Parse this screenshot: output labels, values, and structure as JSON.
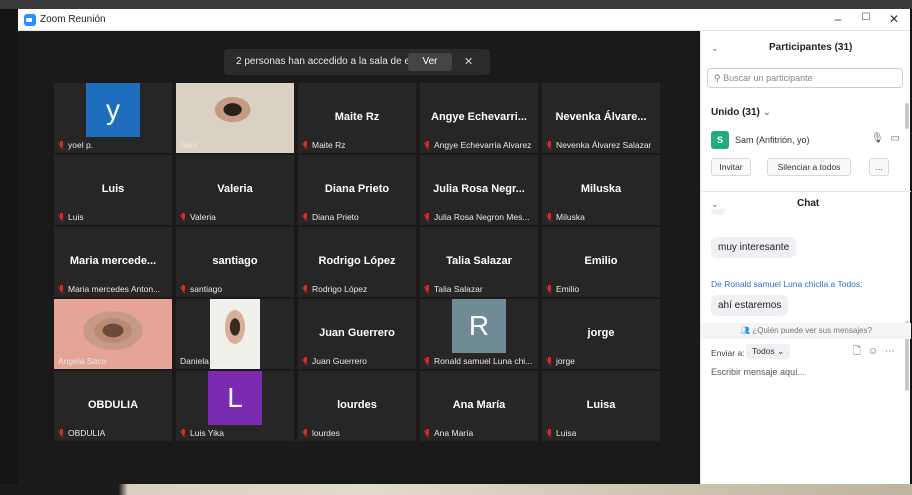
{
  "window": {
    "title": "Zoom Reunión",
    "minimize": "–",
    "maximize": "☐",
    "close": "✕"
  },
  "banner": {
    "text": "2 personas han accedido a la sala de espera",
    "button": "Ver",
    "close": "✕"
  },
  "tiles": [
    {
      "name": "",
      "label": "yoel p.",
      "letter": "y",
      "letter_color": "#1f6dbd"
    },
    {
      "name": "",
      "label": "Sam",
      "photo": true
    },
    {
      "name": "Maite Rz",
      "label": "Maite Rz"
    },
    {
      "name": "Angye Echevarri...",
      "label": "Angye Echevarria Alvarez"
    },
    {
      "name": "Nevenka Álvare...",
      "label": "Nevenka Álvarez Salazar"
    },
    {
      "name": "Luis",
      "label": "Luis"
    },
    {
      "name": "Valeria",
      "label": "Valeria"
    },
    {
      "name": "Diana Prieto",
      "label": "Diana Prieto"
    },
    {
      "name": "Julia Rosa Negr...",
      "label": "Julia Rosa Negron Mes..."
    },
    {
      "name": "Miluska",
      "label": "Miluska"
    },
    {
      "name": "Maria mercede...",
      "label": "Maria mercedes Anton..."
    },
    {
      "name": "santiago",
      "label": "santiago"
    },
    {
      "name": "Rodrigo López",
      "label": "Rodrigo López"
    },
    {
      "name": "Talia Salazar",
      "label": "Talia Salazar"
    },
    {
      "name": "Emilio",
      "label": "Emilio"
    },
    {
      "name": "",
      "label": "Angela Saco",
      "photo": true,
      "active": true
    },
    {
      "name": "",
      "label": "Daniela López",
      "photo": true
    },
    {
      "name": "Juan Guerrero",
      "label": "Juan Guerrero"
    },
    {
      "name": "",
      "label": "Ronald samuel Luna chi...",
      "letter": "R",
      "letter_color": "#6f8c96"
    },
    {
      "name": "jorge",
      "label": "jorge"
    },
    {
      "name": "OBDULIA",
      "label": "OBDULIA"
    },
    {
      "name": "",
      "label": "Luis Yika",
      "letter": "L",
      "letter_color": "#7a2bb0"
    },
    {
      "name": "lourdes",
      "label": "lourdes"
    },
    {
      "name": "Ana María",
      "label": "Ana María"
    },
    {
      "name": "Luisa",
      "label": "Luisa"
    }
  ],
  "participants": {
    "title": "Participantes (31)",
    "search_placeholder": "Buscar un participante",
    "joined": "Unido (31)",
    "host_initial": "S",
    "host_name": "Sam (Anfitrión, yo)",
    "invite": "Invitar",
    "mute_all": "Silenciar a todos",
    "more": "..."
  },
  "chat": {
    "title": "Chat",
    "msg1": "muy interesante",
    "from": "De Ronald samuel Luna chiclla a Todos:",
    "msg2": "ahí estaremos",
    "who_sees": "¿Quién puede ver sus mensajes?",
    "send_to_label": "Enviar a:",
    "send_to_value": "Todos",
    "compose_placeholder": "Escribir mensaje aquí..."
  }
}
